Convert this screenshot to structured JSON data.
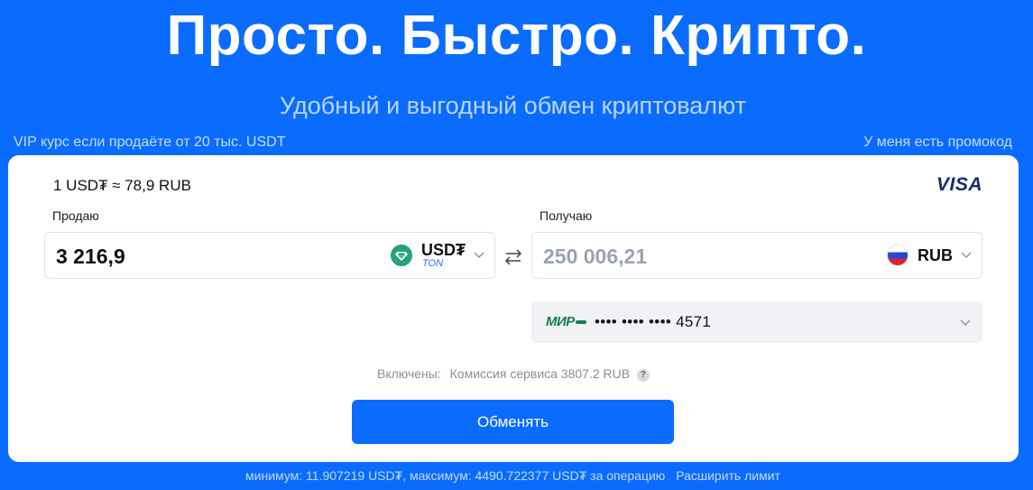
{
  "hero": {
    "title": "Просто. Быстро. Крипто.",
    "subtitle": "Удобный и выгодный обмен криптовалют"
  },
  "links": {
    "vip": "VIP курс если продаёте от 20 тыс. USDT",
    "promo": "У меня есть промокод"
  },
  "card": {
    "rate": "1 USD₮ ≈ 78,9 RUB",
    "payment_logo": "VISA",
    "sell": {
      "label": "Продаю",
      "amount": "3 216,9",
      "currency": "USD₮",
      "network": "TON",
      "icon": "tether-icon"
    },
    "get": {
      "label": "Получаю",
      "amount": "250 006,21",
      "currency": "RUB",
      "icon": "russia-flag-icon"
    },
    "payout_card": {
      "system_logo": "МИР",
      "mask": "•••• •••• •••• 4571"
    },
    "fee": {
      "label": "Включены:",
      "text": "Комиссия сервиса 3807.2 RUB",
      "help": "?"
    },
    "submit_label": "Обменять"
  },
  "limits": {
    "text": "минимум: 11.907219 USD₮, максимум: 4490.722377 USD₮ за операцию",
    "raise_label": "Расширить лимит"
  },
  "colors": {
    "background": "#0a6cff",
    "accent": "#0a6cff",
    "tether": "#26a17b",
    "mir": "#157c4f"
  }
}
